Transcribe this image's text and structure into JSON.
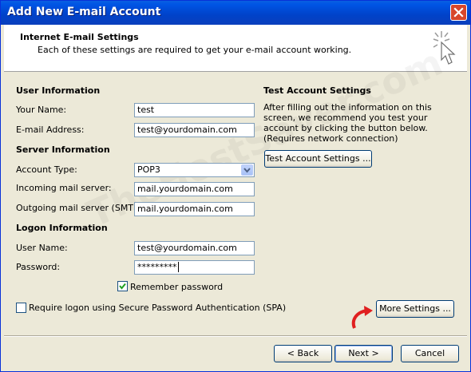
{
  "window": {
    "title": "Add New E-mail Account"
  },
  "header": {
    "title": "Internet E-mail Settings",
    "subtitle": "Each of these settings are required to get your e-mail account working."
  },
  "user_info": {
    "section": "User Information",
    "name_label": "Your Name:",
    "name_value": "test",
    "email_label": "E-mail Address:",
    "email_value": "test@yourdomain.com"
  },
  "server_info": {
    "section": "Server Information",
    "account_type_label": "Account Type:",
    "account_type_value": "POP3",
    "incoming_label": "Incoming mail server:",
    "incoming_value": "mail.yourdomain.com",
    "outgoing_label": "Outgoing mail server (SMTP):",
    "outgoing_value": "mail.yourdomain.com"
  },
  "logon_info": {
    "section": "Logon Information",
    "username_label": "User Name:",
    "username_value": "test@yourdomain.com",
    "password_label": "Password:",
    "password_value": "*********",
    "remember_label": "Remember password",
    "remember_checked": true,
    "spa_label": "Require logon using Secure Password Authentication (SPA)",
    "spa_checked": false
  },
  "test_settings": {
    "section": "Test Account Settings",
    "description": "After filling out the information on this screen, we recommend you test your account by clicking the button below. (Requires network connection)",
    "test_button": "Test Account Settings ...",
    "more_settings_button": "More Settings ..."
  },
  "footer": {
    "back_button": "< Back",
    "next_button": "Next >",
    "cancel_button": "Cancel"
  },
  "watermark": "TheHostSaver.com",
  "colors": {
    "title_bar": "#0055e5",
    "close_button": "#d7472b",
    "arrow_annotation": "#e02020",
    "dialog_bg": "#ece9d8"
  }
}
